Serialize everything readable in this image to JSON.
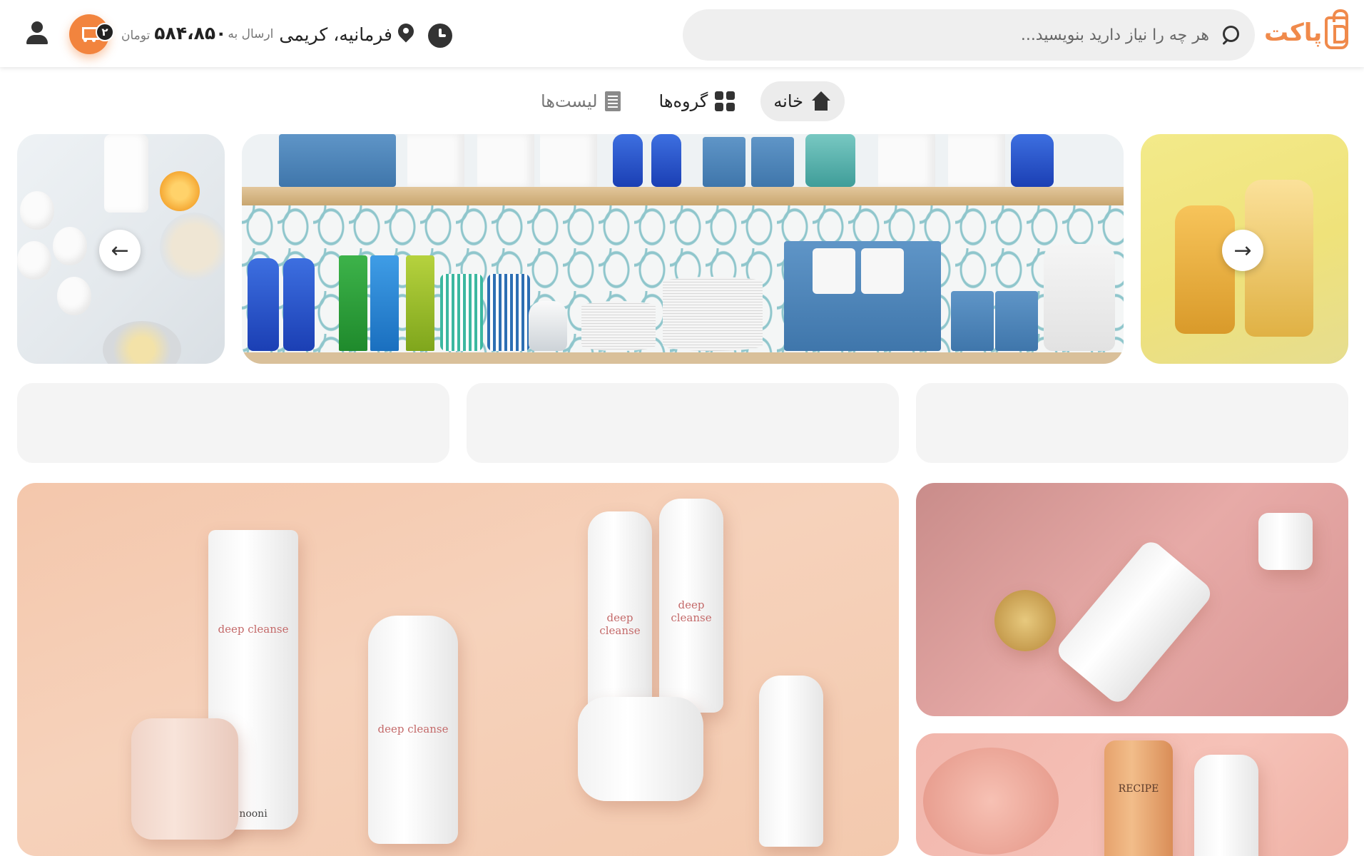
{
  "header": {
    "logo_text": "پاکت",
    "search_placeholder": "هر چه را نیاز دارید بنویسید...",
    "address_prefix": "ارسال به",
    "address_name": "فرمانیه، کریمی",
    "cart_total": "۵۸۴،۸۵۰",
    "currency": "تومان",
    "cart_count": "۲",
    "brand_color": "#f2843e"
  },
  "nav": {
    "items": [
      {
        "label": "خانه",
        "icon": "home-icon",
        "active": true
      },
      {
        "label": "گروه‌ها",
        "icon": "grid-icon",
        "active": false
      },
      {
        "label": "لیست‌ها",
        "icon": "list-icon",
        "active": false
      }
    ]
  },
  "carousel": {
    "slides": [
      {
        "subject": "household supplies shelf"
      },
      {
        "subject": "shampoo bottles"
      },
      {
        "subject": "eggs and milk"
      }
    ],
    "next_icon": "arrow-right-icon",
    "prev_icon": "arrow-left-icon"
  },
  "banners": {
    "big_brand": "nooni",
    "big_label": "deep cleanse",
    "br_label": "RECIPE"
  }
}
